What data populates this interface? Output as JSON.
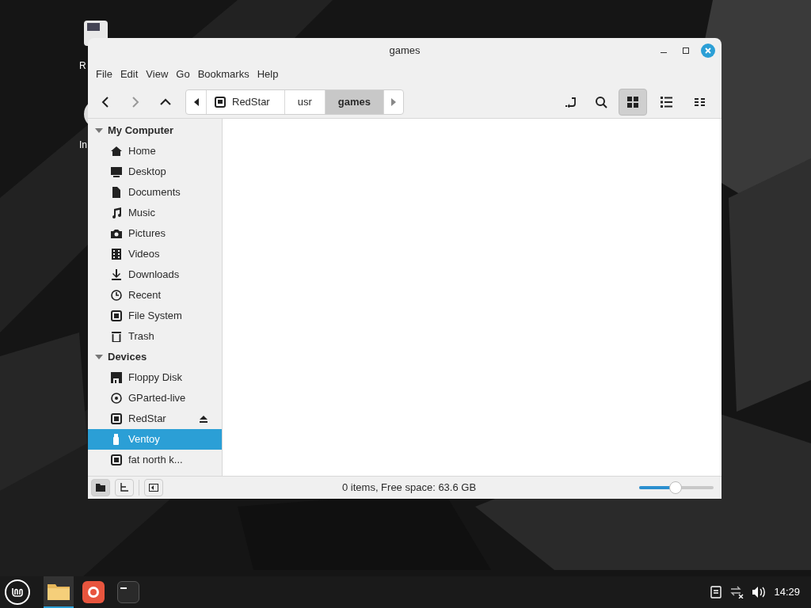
{
  "desktop_icons": [
    {
      "label": "R",
      "kind": "document"
    },
    {
      "label": "In",
      "kind": "disc"
    }
  ],
  "window": {
    "title": "games"
  },
  "menu": [
    "File",
    "Edit",
    "View",
    "Go",
    "Bookmarks",
    "Help"
  ],
  "path": [
    {
      "label": "RedStar",
      "kind": "drive",
      "selected": false
    },
    {
      "label": "usr",
      "kind": "folder",
      "selected": false
    },
    {
      "label": "games",
      "kind": "folder",
      "selected": true
    }
  ],
  "view_buttons": [
    {
      "kind": "icons",
      "selected": true
    },
    {
      "kind": "list",
      "selected": false
    },
    {
      "kind": "compact",
      "selected": false
    }
  ],
  "sidebar": [
    {
      "title": "My Computer",
      "expanded": true,
      "items": [
        {
          "label": "Home",
          "kind": "home",
          "selected": false
        },
        {
          "label": "Desktop",
          "kind": "desktop",
          "selected": false
        },
        {
          "label": "Documents",
          "kind": "document",
          "selected": false
        },
        {
          "label": "Music",
          "kind": "music",
          "selected": false
        },
        {
          "label": "Pictures",
          "kind": "camera",
          "selected": false
        },
        {
          "label": "Videos",
          "kind": "film",
          "selected": false
        },
        {
          "label": "Downloads",
          "kind": "download",
          "selected": false
        },
        {
          "label": "Recent",
          "kind": "clock",
          "selected": false
        },
        {
          "label": "File System",
          "kind": "drive",
          "selected": false
        },
        {
          "label": "Trash",
          "kind": "trash",
          "selected": false
        }
      ]
    },
    {
      "title": "Devices",
      "expanded": true,
      "items": [
        {
          "label": "Floppy Disk",
          "kind": "floppy",
          "selected": false
        },
        {
          "label": "GParted-live",
          "kind": "disc",
          "selected": false
        },
        {
          "label": "RedStar",
          "kind": "drive",
          "selected": false,
          "ejectable": true
        },
        {
          "label": "Ventoy",
          "kind": "usb",
          "selected": true
        },
        {
          "label": "fat north k...",
          "kind": "drive",
          "selected": false
        }
      ]
    }
  ],
  "status_bar": {
    "pane_buttons": [
      {
        "kind": "places",
        "selected": true
      },
      {
        "kind": "tree",
        "selected": false
      }
    ],
    "text": "0 items, Free space: 63.6 GB",
    "zoom": {
      "level": 0.49
    }
  },
  "taskbar": {
    "apps": [
      {
        "kind": "files",
        "selected": true
      },
      {
        "kind": "browser",
        "selected": false
      },
      {
        "kind": "terminal",
        "selected": false
      }
    ],
    "clock": "14:29"
  }
}
